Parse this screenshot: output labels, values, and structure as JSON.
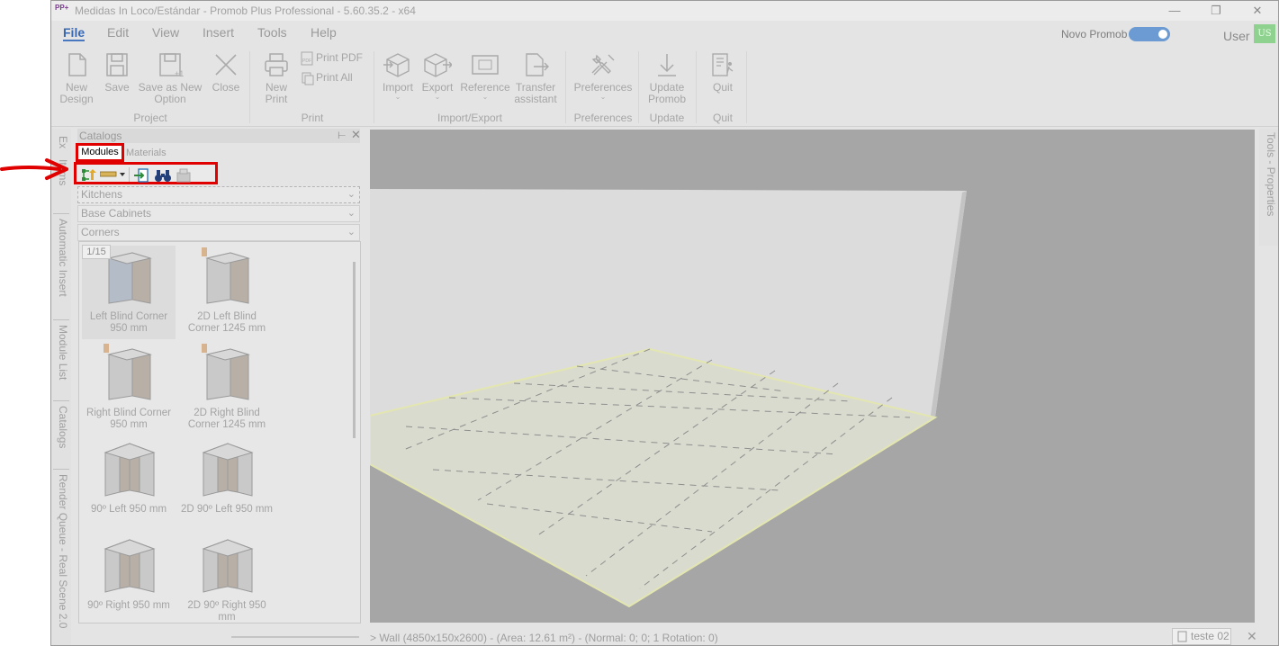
{
  "window": {
    "title": "Medidas In Loco/Estándar - Promob Plus Professional - 5.60.35.2 - x64",
    "logo_text": "PP+"
  },
  "menu": {
    "items": [
      "File",
      "Edit",
      "View",
      "Insert",
      "Tools",
      "Help"
    ],
    "active": "File"
  },
  "top_right": {
    "novo_label": "Novo Promob",
    "novo_toggle_on": true,
    "user_label": "User",
    "user_initials": "US"
  },
  "ribbon": {
    "project": {
      "label": "Project",
      "new_design": [
        "New",
        "Design"
      ],
      "save": "Save",
      "save_as": [
        "Save as New",
        "Option"
      ],
      "close": "Close"
    },
    "print": {
      "label": "Print",
      "new_print": [
        "New",
        "Print"
      ],
      "print_pdf": "Print PDF",
      "print_all": "Print All"
    },
    "import_export": {
      "label": "Import/Export",
      "import": "Import",
      "export": "Export",
      "reference": "Reference",
      "transfer": [
        "Transfer",
        "assistant"
      ]
    },
    "preferences": {
      "label": "Preferences",
      "preferences": "Preferences"
    },
    "update": {
      "label": "Update",
      "update": [
        "Update",
        "Promob"
      ]
    },
    "quit": {
      "label": "Quit",
      "quit": "Quit"
    }
  },
  "left_tabs": [
    "Ex",
    "Items",
    "Automatic Insert",
    "Module List",
    "Catalogs",
    "Render Queue - Real Scene 2.0"
  ],
  "catalogs": {
    "title": "Catalogs",
    "tabs": [
      "Modules",
      "Materials"
    ],
    "dropdowns": [
      "Kitchens",
      "Base Cabinets",
      "Corners"
    ],
    "page_indicator": "1/15",
    "items": [
      {
        "label": "Left Blind Corner 950 mm",
        "selected": true
      },
      {
        "label": "2D Left Blind Corner 1245 mm",
        "selected": false
      },
      {
        "label": "Right Blind Corner 950 mm",
        "selected": false
      },
      {
        "label": "2D Right Blind Corner 1245 mm",
        "selected": false
      },
      {
        "label": "90º Left 950 mm",
        "selected": false
      },
      {
        "label": "2D 90º Left 950 mm",
        "selected": false
      },
      {
        "label": "90º Right 950 mm",
        "selected": false
      },
      {
        "label": "2D 90º Right 950 mm",
        "selected": false
      }
    ]
  },
  "right_tabs": [
    "Tools - Properties"
  ],
  "status": {
    "text": "> Wall (4850x150x2600) - (Area: 12.61 m²) - (Normal: 0; 0; 1 Rotation: 0)",
    "scene_tab": "teste 02"
  },
  "colors": {
    "accent": "#3a69b3",
    "highlight_box": "#e00000",
    "toggle": "#6b9bd2",
    "avatar": "#8fd18f"
  }
}
